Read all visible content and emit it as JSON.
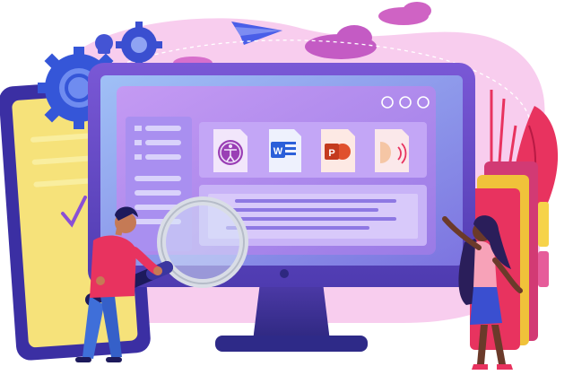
{
  "illustration": {
    "file_icons": [
      {
        "name": "accessibility-icon"
      },
      {
        "name": "word-icon",
        "letter": "W"
      },
      {
        "name": "powerpoint-icon",
        "letter": "P"
      },
      {
        "name": "audio-icon"
      }
    ],
    "window_controls": [
      {
        "name": "window-control-1"
      },
      {
        "name": "window-control-2"
      },
      {
        "name": "window-control-3"
      }
    ],
    "colors": {
      "blob_pink": "#f7c7ec",
      "cloud_purple": "#c75ec9",
      "monitor_frame": "#6a4cc9",
      "screen_blue": "#8fb3f2",
      "window_purple": "#b98df0",
      "accent_red": "#e8335f",
      "navy": "#1d1a5c",
      "clipboard_yellow": "#f6e27a",
      "word_blue": "#2b5fd9",
      "ppt_orange": "#e0502d"
    }
  }
}
